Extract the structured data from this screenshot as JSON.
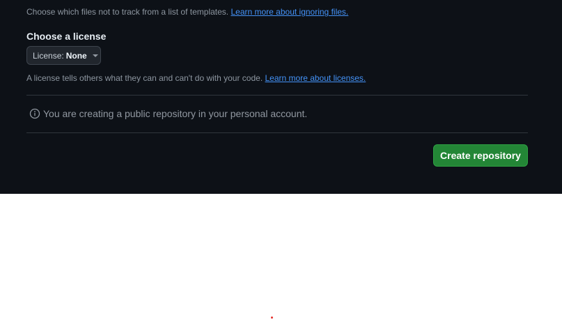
{
  "gitignore": {
    "description": "Choose which files not to track from a list of templates.",
    "learn_more": "Learn more about ignoring files."
  },
  "license": {
    "heading": "Choose a license",
    "button_prefix": "License:",
    "button_value": "None",
    "description": "A license tells others what they can and can't do with your code.",
    "learn_more": "Learn more about licenses."
  },
  "info": {
    "icon": "info-icon",
    "message": "You are creating a public repository in your personal account."
  },
  "actions": {
    "create_label": "Create repository"
  },
  "colors": {
    "background_dark": "#0d1117",
    "accent_link": "#4493f8",
    "primary_button": "#238636",
    "cursor_dot": "#e5322d"
  }
}
